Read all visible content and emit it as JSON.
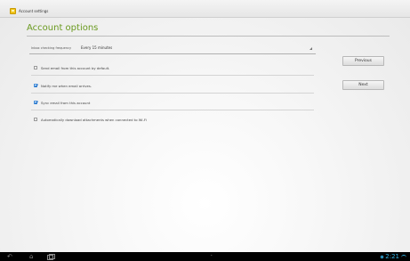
{
  "window": {
    "title": "Account settings",
    "icon": "email-app-icon"
  },
  "main": {
    "heading": "Account options",
    "frequency": {
      "label": "Inbox checking frequency",
      "value": "Every 15 minutes"
    },
    "options": [
      {
        "label": "Send email from this account by default.",
        "checked": false
      },
      {
        "label": "Notify me when email arrives.",
        "checked": true
      },
      {
        "label": "Sync email from this account",
        "checked": true
      },
      {
        "label": "Automatically download attachments when connected to Wi-Fi",
        "checked": false
      }
    ]
  },
  "buttons": {
    "previous": "Previous",
    "next": "Next"
  },
  "system_bar": {
    "icons": [
      "back-icon",
      "home-icon",
      "recent-apps-icon",
      "up-arrow-icon"
    ],
    "clock": "2:21",
    "accent_color": "#33b5e5"
  },
  "colors": {
    "heading": "#6a9a1f",
    "checkbox_checked": "#1e6fc8"
  }
}
